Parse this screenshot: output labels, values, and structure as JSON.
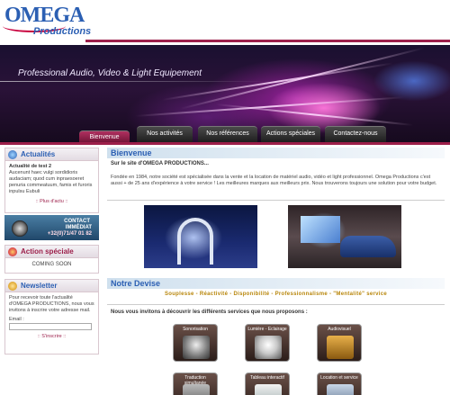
{
  "logo": {
    "main": "OMEGA",
    "sub": "Productions"
  },
  "banner": {
    "tagline": "Professional Audio, Video & Light Equipement"
  },
  "nav": {
    "items": [
      {
        "label": "Bienvenue",
        "active": true
      },
      {
        "label": "Nos activités",
        "active": false
      },
      {
        "label": "Nos références",
        "active": false
      },
      {
        "label": "Actions spéciales",
        "active": false
      },
      {
        "label": "Contactez-nous",
        "active": false
      }
    ]
  },
  "sidebar": {
    "actualites": {
      "title": "Actualités",
      "item_title": "Actualité de test 2",
      "item_text": "Aucenunt haec vulgi sordidioris audaciam; quod cum inpraesoeret penuria commeatuum, famis et furoris inpulsu Eubuli",
      "more": ":: Plus d'actu ::"
    },
    "contact": {
      "line1": "CONTACT",
      "line2": "IMMÉDIAT",
      "phone": "+32(0)71/47 01 82"
    },
    "action": {
      "title": "Action spéciale",
      "text": "COMING SOON"
    },
    "newsletter": {
      "title": "Newsletter",
      "text": "Pour recevoir toute l'actualité d'OMEGA PRODUCTIONS, nous vous invitons à inscrire votre adresse mail.",
      "email_label": "Email :",
      "email_value": "",
      "subscribe": ":: S'inscrire ::"
    }
  },
  "main": {
    "welcome": {
      "title": "Bienvenue",
      "subtitle": "Sur le site d'OMEGA PRODUCTIONS...",
      "intro": "Fondée en 1984, notre société est spécialisée dans la vente et la location de matériel audio, vidéo et light professionnel. Omega Productions c'est aussi + de 25 ans d'expérience à votre service ! Les meilleures marques aux meilleurs prix. Nous trouverons toujours une solution pour votre budget."
    },
    "devise": {
      "title": "Notre Devise",
      "motto": "Souplesse - Réactivité - Disponibilité - Professionnalisme - \"Mentalité\" service",
      "invite": "Nous vous invitons à découvrir les différents services que nous proposons :"
    },
    "services": [
      {
        "label": "Sonorisation"
      },
      {
        "label": "Lumière - Eclairage"
      },
      {
        "label": "Audiovisuel"
      },
      {
        "label": "Traduction simultanée"
      },
      {
        "label": "Tableau interactif"
      },
      {
        "label": "Location et service"
      }
    ]
  },
  "colors": {
    "accent": "#9c1f4a",
    "title": "#2b5fb3",
    "gold": "#b8860b"
  }
}
